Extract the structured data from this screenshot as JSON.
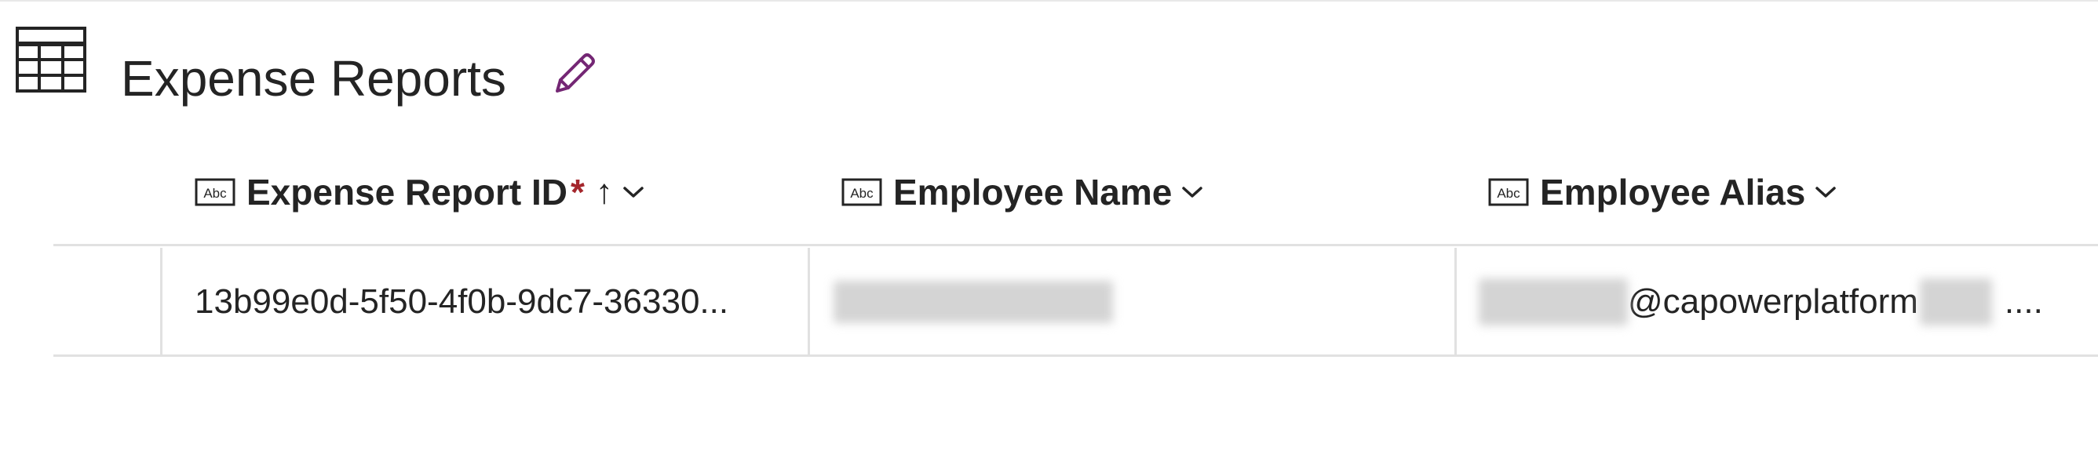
{
  "header": {
    "title": "Expense Reports"
  },
  "columns": [
    {
      "label": "Expense Report ID",
      "required_marker": "*",
      "sort_indicator": "↑",
      "type_icon": "text-field-icon"
    },
    {
      "label": "Employee Name",
      "type_icon": "text-field-icon"
    },
    {
      "label": "Employee Alias",
      "type_icon": "text-field-icon"
    }
  ],
  "rows": [
    {
      "expense_report_id": "13b99e0d-5f50-4f0b-9dc7-36330...",
      "employee_name": "",
      "employee_alias_suffix": "@capowerplatform",
      "employee_alias_trailing": "...."
    }
  ],
  "colors": {
    "required": "#a4262c",
    "edit_icon": "#742774",
    "text": "#242424",
    "grid_line": "#e1e1e1"
  }
}
